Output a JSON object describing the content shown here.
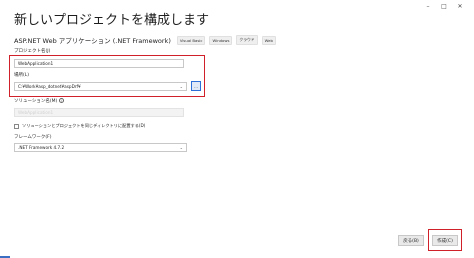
{
  "window_controls": {
    "minimize": "–",
    "maximize": "□",
    "close": "✕"
  },
  "title": "新しいプロジェクトを構成します",
  "template": {
    "name": "ASP.NET Web アプリケーション (.NET Framework)",
    "tags": [
      "Visual Basic",
      "Windows",
      "クラウド",
      "Web"
    ]
  },
  "project_name": {
    "label": "プロジェクト名(J)",
    "value": "WebApplication1"
  },
  "location": {
    "label": "場所(L)",
    "value": "C:¥Work¥asp_dotnet¥aspDrf¥",
    "browse_label": "..."
  },
  "solution_name": {
    "label": "ソリューション名(M)",
    "help": "i",
    "value": "WebApplication1"
  },
  "same_directory": {
    "label": "ソリューションとプロジェクトを同じディレクトリに配置する(D)",
    "checked": false
  },
  "framework": {
    "label": "フレームワーク(F)",
    "value": ".NET Framework 4.7.2"
  },
  "buttons": {
    "back": "戻る(B)",
    "create": "作成(C)"
  },
  "colors": {
    "highlight": "#d0202a",
    "accent": "#2d6fd6"
  }
}
